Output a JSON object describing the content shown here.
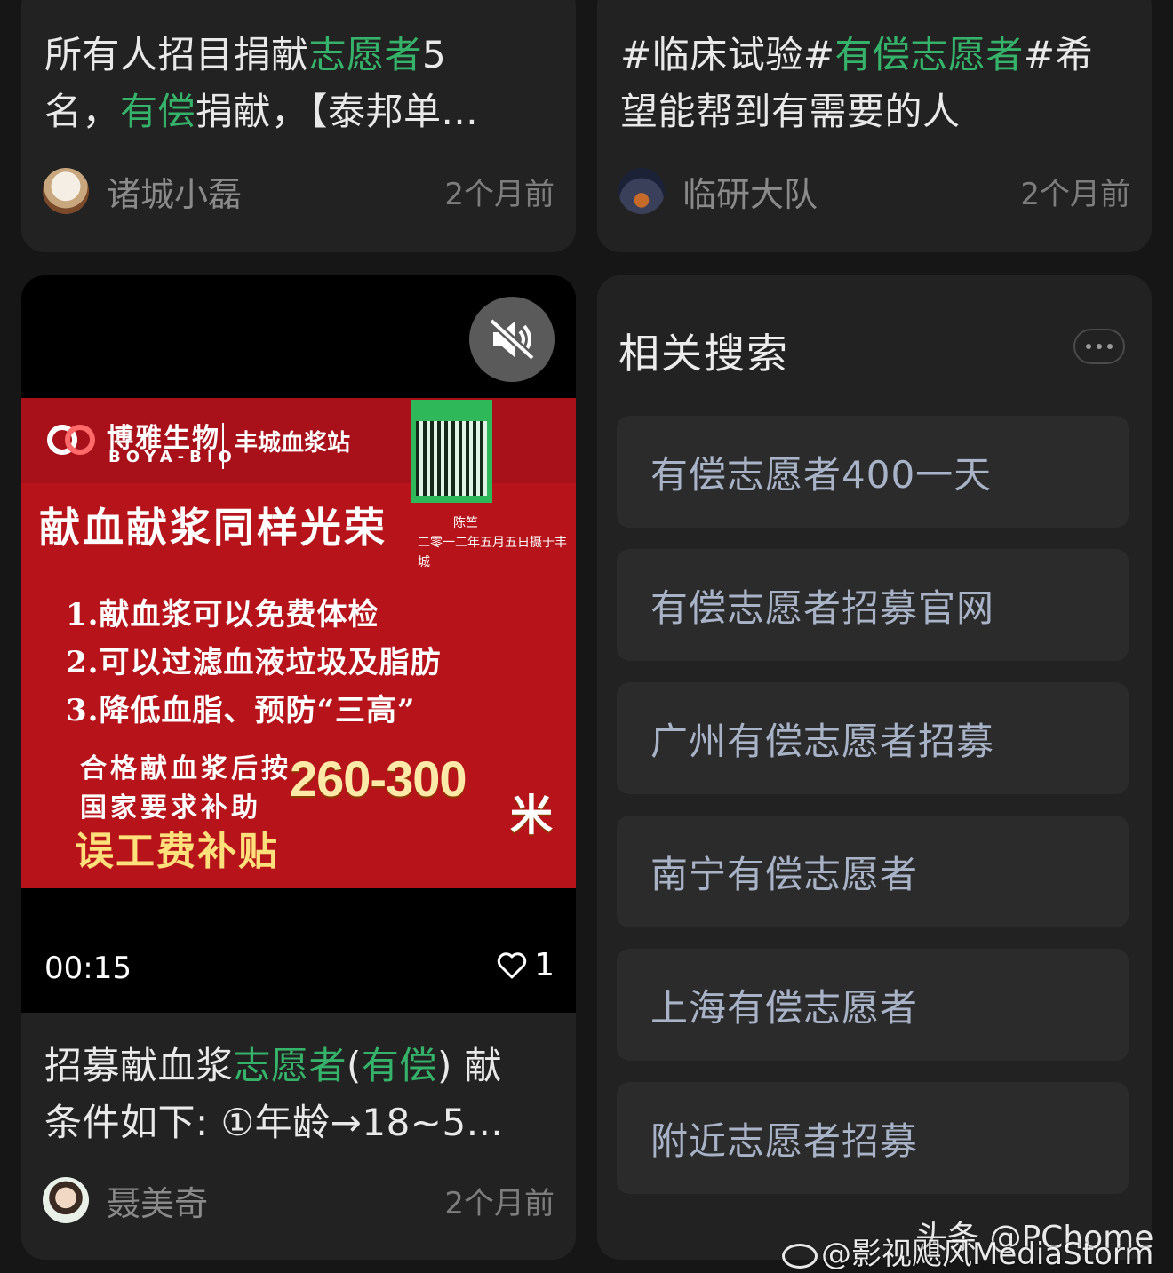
{
  "cards": [
    {
      "title_parts": [
        {
          "text": "所有人招目捐献",
          "hl": false
        },
        {
          "text": "志愿者",
          "hl": true
        },
        {
          "text": "5",
          "hl": false
        }
      ],
      "title_line2_parts": [
        {
          "text": "名，",
          "hl": false
        },
        {
          "text": "有偿",
          "hl": true
        },
        {
          "text": "捐献，【泰邦单...",
          "hl": false
        }
      ],
      "author": "诸城小磊",
      "time": "2个月前"
    },
    {
      "title_parts": [
        {
          "text": "#临床试验#",
          "hl": false
        },
        {
          "text": "有偿志愿者",
          "hl": true
        },
        {
          "text": "#希",
          "hl": false
        }
      ],
      "title_line2_parts": [
        {
          "text": "望能帮到有需要的人",
          "hl": false
        }
      ],
      "author": "临研大队",
      "time": "2个月前"
    },
    {
      "title_parts": [
        {
          "text": "招募献血浆",
          "hl": false
        },
        {
          "text": "志愿者",
          "hl": true
        },
        {
          "text": "(",
          "hl": false
        },
        {
          "text": "有偿",
          "hl": true
        },
        {
          "text": ") 献",
          "hl": false
        }
      ],
      "title_line2_parts": [
        {
          "text": "条件如下: ①年龄→18~5...",
          "hl": false
        }
      ],
      "author": "聂美奇",
      "time": "2个月前"
    }
  ],
  "video": {
    "duration": "00:15",
    "likes": "1",
    "poster": {
      "brand_cn": "博雅生物",
      "brand_en": "BOYA-BIO",
      "station": "丰城血浆站",
      "slogan": "献血献浆同样光荣",
      "signature_name": "陈竺",
      "signature_date": "二零一二年五月五日摄于丰城",
      "benefits": [
        "1.献血浆可以免费体检",
        "2.可以过滤血液垃圾及脂肪",
        "3.降低血脂、预防“三高”"
      ],
      "sub_line1": "合格献血浆后按",
      "sub_line2": "国家要求补助",
      "price": "260-300",
      "price_unit": "米",
      "subsidy": "误工费补贴"
    }
  },
  "related": {
    "title": "相关搜索",
    "items": [
      "有偿志愿者400一天",
      "有偿志愿者招募官网",
      "广州有偿志愿者招募",
      "南宁有偿志愿者",
      "上海有偿志愿者",
      "附近志愿者招募"
    ]
  },
  "watermarks": {
    "weibo": "@影视飓风MediaStorm",
    "toutiao": "头条 @PChome"
  },
  "colors": {
    "background": "#161616",
    "card": "#222222",
    "highlight": "#36b36a",
    "related_text": "#a8b3c8",
    "poster_red": "#b6141a"
  },
  "icons": {
    "mute": "speaker-muted-icon",
    "like": "heart-outline-icon",
    "more": "more-dots-icon",
    "weibo": "weibo-logo-icon"
  }
}
